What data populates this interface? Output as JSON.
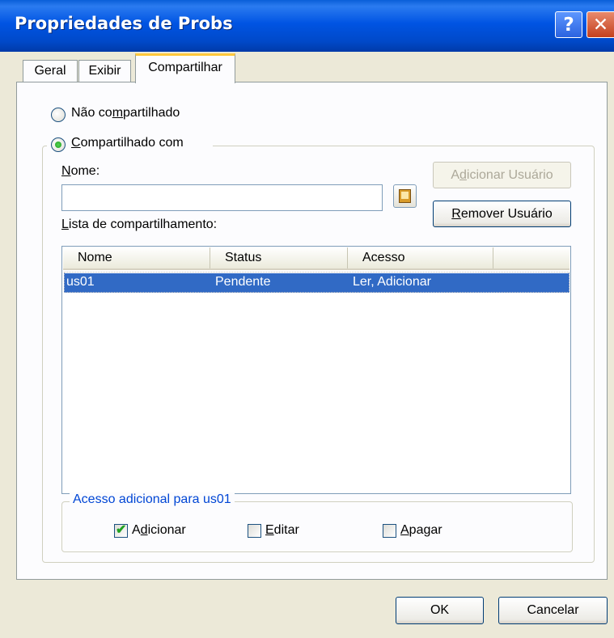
{
  "window": {
    "title": "Propriedades de Probs"
  },
  "titlebar_buttons": {
    "help_label": "?",
    "close_label": "✕"
  },
  "tabs": [
    {
      "label": "Geral"
    },
    {
      "label": "Exibir"
    },
    {
      "label": "Compartilhar",
      "active": true
    }
  ],
  "sharing": {
    "not_shared_label_pre": "Não co",
    "not_shared_label_u": "m",
    "not_shared_label_post": "partilhado",
    "shared_with_label_u": "C",
    "shared_with_label_post": "ompartilhado com",
    "selected": "shared_with"
  },
  "name_field": {
    "label_u": "N",
    "label_post": "ome:",
    "value": ""
  },
  "buttons": {
    "add_user_pre": "A",
    "add_user_u": "d",
    "add_user_post": "icionar Usuário",
    "remove_user_u": "R",
    "remove_user_post": "emover Usuário",
    "ok": "OK",
    "cancel": "Cancelar"
  },
  "share_list": {
    "label_u": "L",
    "label_post": "ista de compartilhamento:",
    "columns": [
      "Nome",
      "Status",
      "Acesso"
    ],
    "rows": [
      {
        "nome": "us01",
        "status": "Pendente",
        "acesso": "Ler, Adicionar",
        "selected": true
      }
    ]
  },
  "additional_access": {
    "title": "Acesso adicional para us01",
    "options": [
      {
        "pre": "A",
        "u": "d",
        "post": "icionar",
        "checked": true
      },
      {
        "pre": "",
        "u": "E",
        "post": "ditar",
        "checked": false
      },
      {
        "pre": "",
        "u": "A",
        "post": "pagar",
        "checked": false
      }
    ]
  },
  "colors": {
    "accent": "#0054e3",
    "selection": "#316ac5",
    "group_title": "#0046d5"
  }
}
